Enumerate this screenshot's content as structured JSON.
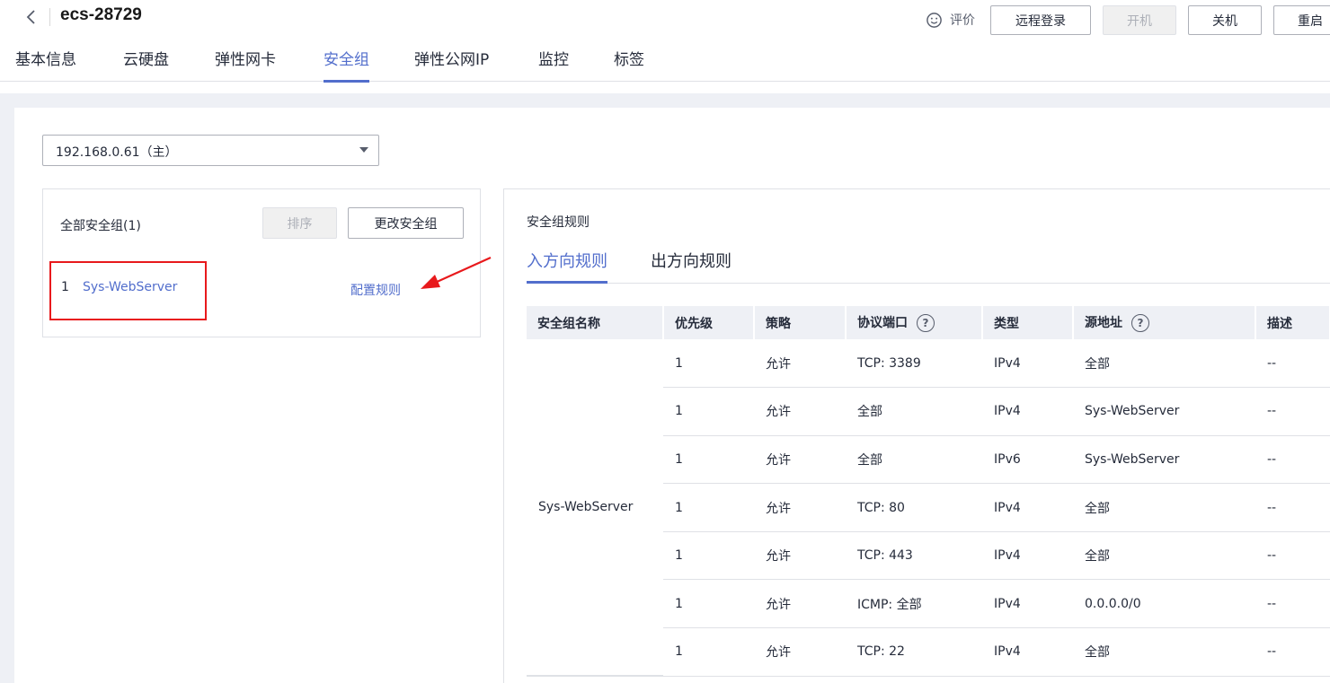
{
  "header": {
    "title": "ecs-28729",
    "rate_label": "评价",
    "buttons": {
      "remote_login": "远程登录",
      "power_on": "开机",
      "power_off": "关机",
      "restart": "重启"
    }
  },
  "tabs": [
    "基本信息",
    "云硬盘",
    "弹性网卡",
    "安全组",
    "弹性公网IP",
    "监控",
    "标签"
  ],
  "active_tab": "安全组",
  "nic_select": {
    "value": "192.168.0.61（主）"
  },
  "left_panel": {
    "title": "全部安全组(1)",
    "sort_label": "排序",
    "change_label": "更改安全组",
    "groups": [
      {
        "index": "1",
        "name": "Sys-WebServer",
        "config_label": "配置规则"
      }
    ]
  },
  "rules_panel": {
    "title": "安全组规则",
    "tabs": [
      "入方向规则",
      "出方向规则"
    ],
    "active_tab": "入方向规则",
    "columns": [
      "安全组名称",
      "优先级",
      "策略",
      "协议端口",
      "类型",
      "源地址",
      "描述"
    ],
    "group_name": "Sys-WebServer",
    "rows": [
      {
        "priority": "1",
        "policy": "允许",
        "port": "TCP: 3389",
        "type": "IPv4",
        "source": "全部",
        "desc": "--"
      },
      {
        "priority": "1",
        "policy": "允许",
        "port": "全部",
        "type": "IPv4",
        "source": "Sys-WebServer",
        "desc": "--"
      },
      {
        "priority": "1",
        "policy": "允许",
        "port": "全部",
        "type": "IPv6",
        "source": "Sys-WebServer",
        "desc": "--"
      },
      {
        "priority": "1",
        "policy": "允许",
        "port": "TCP: 80",
        "type": "IPv4",
        "source": "全部",
        "desc": "--"
      },
      {
        "priority": "1",
        "policy": "允许",
        "port": "TCP: 443",
        "type": "IPv4",
        "source": "全部",
        "desc": "--"
      },
      {
        "priority": "1",
        "policy": "允许",
        "port": "ICMP: 全部",
        "type": "IPv4",
        "source": "0.0.0.0/0",
        "desc": "--"
      },
      {
        "priority": "1",
        "policy": "允许",
        "port": "TCP: 22",
        "type": "IPv4",
        "source": "全部",
        "desc": "--"
      }
    ]
  },
  "colors": {
    "accent": "#526ecc",
    "highlight_box": "#e8191c",
    "annotation_arrow": "#e8191c"
  },
  "icons": {
    "back": "chevron-left-icon",
    "rate": "smiley-icon",
    "select": "caret-down-icon",
    "help": "question-circle-icon",
    "annotation": "red-arrow-icon"
  }
}
